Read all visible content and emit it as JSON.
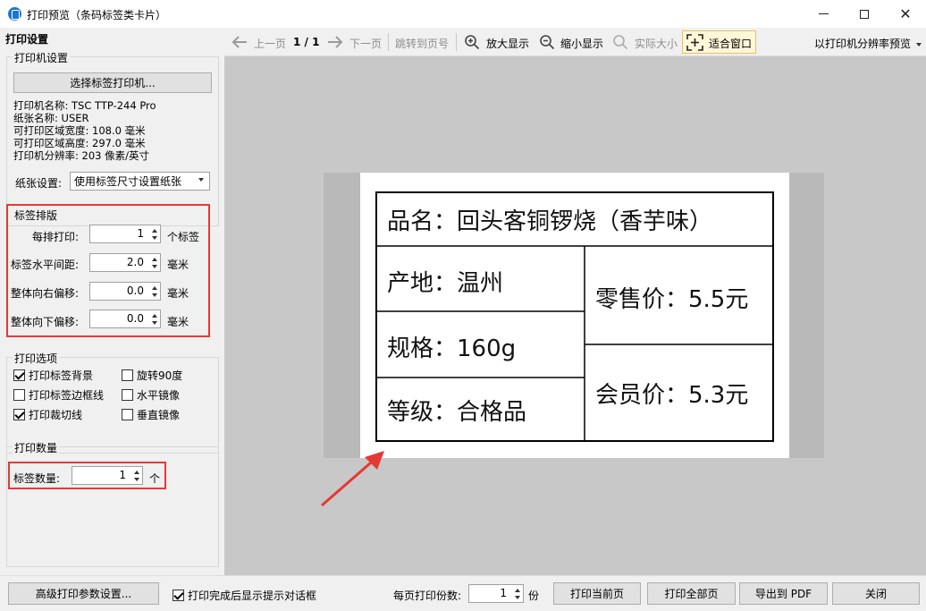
{
  "window": {
    "title": "打印预览（条码标签类卡片）",
    "minimize_icon": "minimize-icon",
    "maximize_icon": "maximize-icon",
    "close_icon": "close-icon"
  },
  "left": {
    "header": "打印设置",
    "printer_group": {
      "title": "打印机设置",
      "select_button": "选择标签打印机...",
      "info": [
        "打印机名称: TSC TTP-244 Pro",
        "纸张名称: USER",
        "可打印区域宽度: 108.0 毫米",
        "可打印区域高度: 297.0 毫米",
        "打印机分辨率: 203 像素/英寸"
      ],
      "paper_label": "纸张设置:",
      "paper_value": "使用标签尺寸设置纸张"
    },
    "layout_group": {
      "title": "标签排版",
      "rows": [
        {
          "label": "每排打印:",
          "value": "1",
          "unit": "个标签"
        },
        {
          "label": "标签水平间距:",
          "value": "2.0",
          "unit": "毫米"
        },
        {
          "label": "整体向右偏移:",
          "value": "0.0",
          "unit": "毫米"
        },
        {
          "label": "整体向下偏移:",
          "value": "0.0",
          "unit": "毫米"
        }
      ]
    },
    "options_group": {
      "title": "打印选项",
      "items": [
        {
          "label": "打印标签背景",
          "checked": true
        },
        {
          "label": "旋转90度",
          "checked": false
        },
        {
          "label": "打印标签边框线",
          "checked": false
        },
        {
          "label": "水平镜像",
          "checked": false
        },
        {
          "label": "打印裁切线",
          "checked": true
        },
        {
          "label": "垂直镜像",
          "checked": false
        }
      ]
    },
    "quantity_group": {
      "title": "打印数量",
      "label": "标签数量:",
      "value": "1",
      "unit": "个"
    }
  },
  "toolbar": {
    "prev": "上一页",
    "page": "1 / 1",
    "next": "下一页",
    "goto": "跳转到页号",
    "zoom_in": "放大显示",
    "zoom_out": "缩小显示",
    "actual": "实际大小",
    "fit": "适合窗口",
    "resolution": "以打印机分辨率预览"
  },
  "label": {
    "name": "品名：回头客铜锣烧（香芋味）",
    "origin": "产地：温州",
    "spec": "规格：160g",
    "grade": "等级：合格品",
    "retail": "零售价：5.5元",
    "member": "会员价：5.3元"
  },
  "bottom": {
    "advanced": "高级打印参数设置...",
    "show_dialog": "打印完成后显示提示对话框",
    "show_dialog_checked": true,
    "copies_label": "每页打印份数:",
    "copies_value": "1",
    "copies_unit": "份",
    "print_current": "打印当前页",
    "print_all": "打印全部页",
    "export_pdf": "导出到 PDF",
    "close": "关闭"
  }
}
